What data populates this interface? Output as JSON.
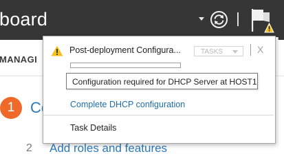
{
  "header": {
    "title": "board",
    "icons": {
      "dropdown": "chevron-down-icon",
      "refresh": "refresh-icon",
      "notifications": "notification-flag-icon"
    }
  },
  "page": {
    "nav_label": "MANAGI",
    "steps": [
      {
        "number": "1",
        "label": "Co"
      },
      {
        "number": "2",
        "label": "Add roles and features"
      }
    ]
  },
  "notification": {
    "title": "Post-deployment Configura...",
    "tasks_button": "TASKS",
    "close": "X",
    "progress_fraction": 0.0,
    "tooltip": "Configuration required for DHCP Server at HOST1",
    "link": "Complete DHCP configuration",
    "task_details": "Task Details"
  },
  "colors": {
    "header_bg": "#363636",
    "warning": "#f4c11e",
    "step_active": "#ef6a2a",
    "link": "#1e6eab"
  }
}
